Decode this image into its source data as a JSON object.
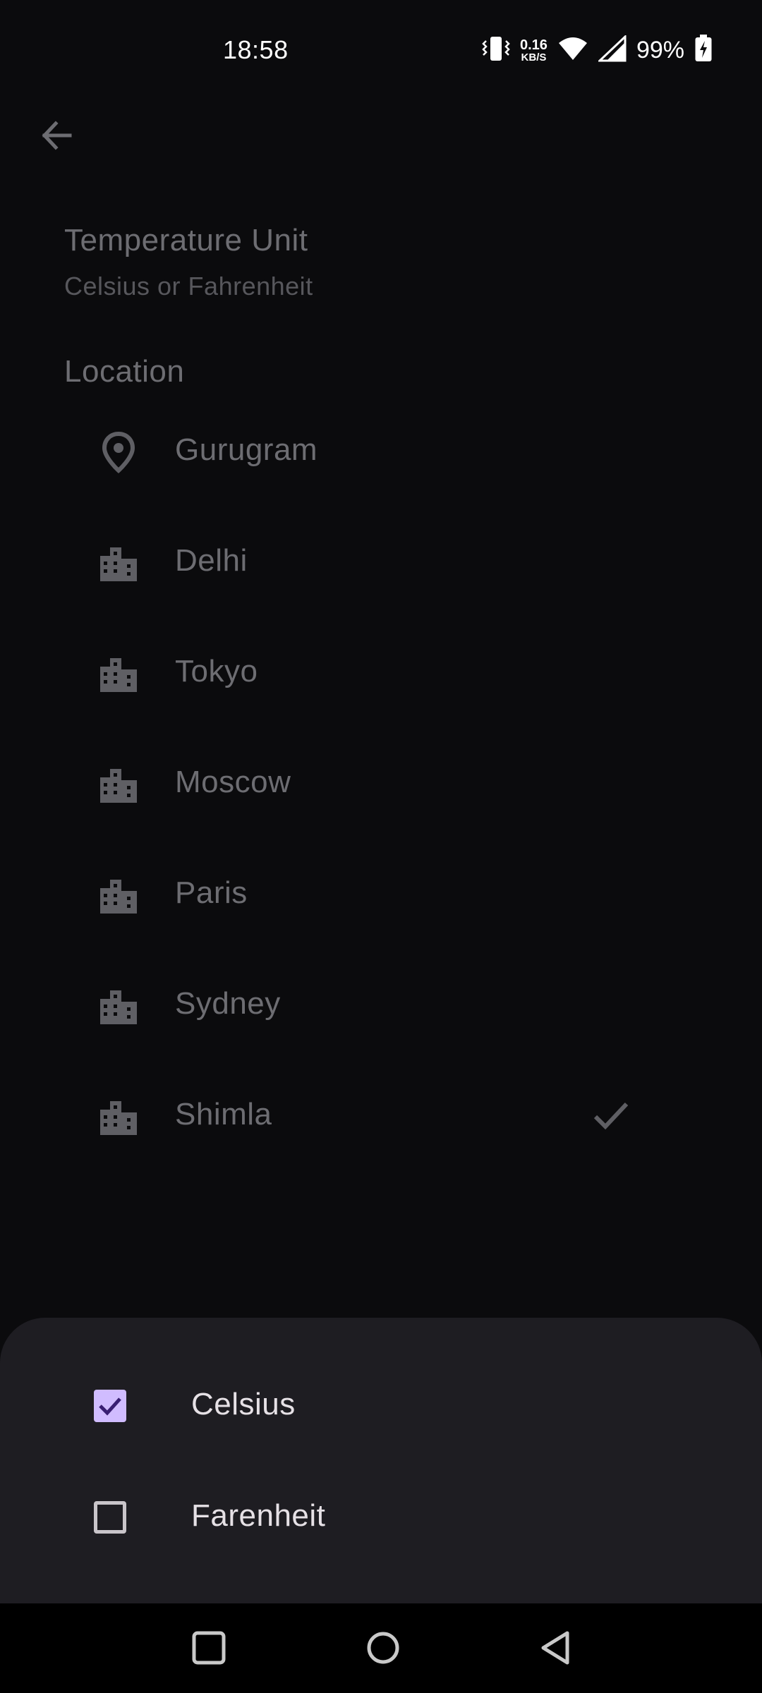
{
  "status_bar": {
    "time": "18:58",
    "net_speed_value": "0.16",
    "net_speed_unit": "KB/S",
    "battery": "99%",
    "icons": [
      "vibrate-icon",
      "wifi-icon",
      "signal-icon",
      "battery-charging-icon"
    ]
  },
  "header": {
    "back_icon": "arrow-back-icon"
  },
  "temperature_pref": {
    "title": "Temperature Unit",
    "summary": "Celsius or Fahrenheit"
  },
  "location": {
    "title": "Location",
    "items": [
      {
        "label": "Gurugram",
        "icon": "location-pin-icon",
        "selected": false
      },
      {
        "label": "Delhi",
        "icon": "city-icon",
        "selected": false
      },
      {
        "label": "Tokyo",
        "icon": "city-icon",
        "selected": false
      },
      {
        "label": "Moscow",
        "icon": "city-icon",
        "selected": false
      },
      {
        "label": "Paris",
        "icon": "city-icon",
        "selected": false
      },
      {
        "label": "Sydney",
        "icon": "city-icon",
        "selected": false
      },
      {
        "label": "Shimla",
        "icon": "city-icon",
        "selected": true
      }
    ]
  },
  "unit_sheet": {
    "options": [
      {
        "label": "Celsius",
        "checked": true
      },
      {
        "label": "Farenheit",
        "checked": false
      }
    ]
  },
  "colors": {
    "background": "#0b0b0d",
    "sheet": "#1e1d22",
    "accent": "#d0bcff",
    "dim_text": "#6d6d72"
  },
  "nav_bar": {
    "icons": [
      "recents-icon",
      "home-icon",
      "back-icon"
    ]
  }
}
